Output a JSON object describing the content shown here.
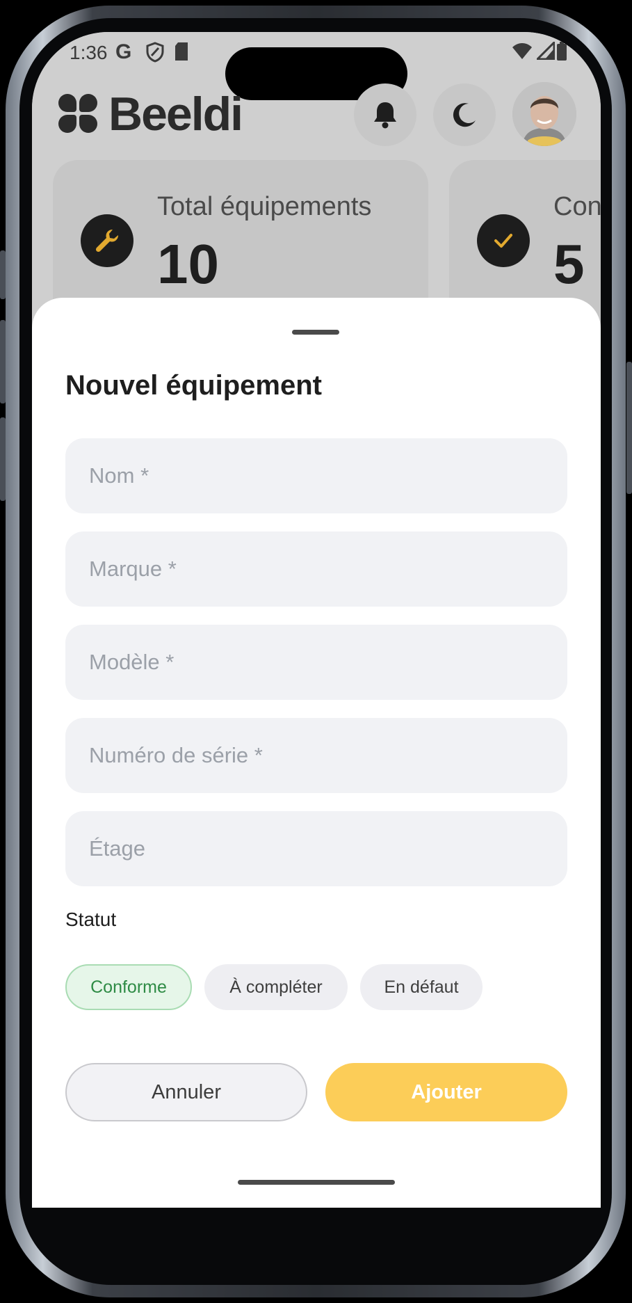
{
  "status_bar": {
    "time": "1:36",
    "carrier_icon": "G"
  },
  "header": {
    "logo_text": "Beeldi",
    "bell_icon": "bell-icon",
    "theme_icon": "moon-icon"
  },
  "stats": [
    {
      "label": "Total équipements",
      "value": "10",
      "icon": "wrench-icon"
    },
    {
      "label": "Con",
      "value": "5",
      "icon": "check-icon"
    }
  ],
  "sheet": {
    "title": "Nouvel équipement",
    "fields": {
      "name_placeholder": "Nom *",
      "brand_placeholder": "Marque *",
      "model_placeholder": "Modèle *",
      "serial_placeholder": "Numéro de série *",
      "floor_placeholder": "Étage"
    },
    "status_label": "Statut",
    "status_options": [
      "Conforme",
      "À compléter",
      "En défaut"
    ],
    "selected_status": "Conforme",
    "cancel_label": "Annuler",
    "add_label": "Ajouter"
  },
  "colors": {
    "accent_yellow": "#fccd58",
    "selected_green": "#2e8b45",
    "field_bg": "#f1f2f5"
  }
}
